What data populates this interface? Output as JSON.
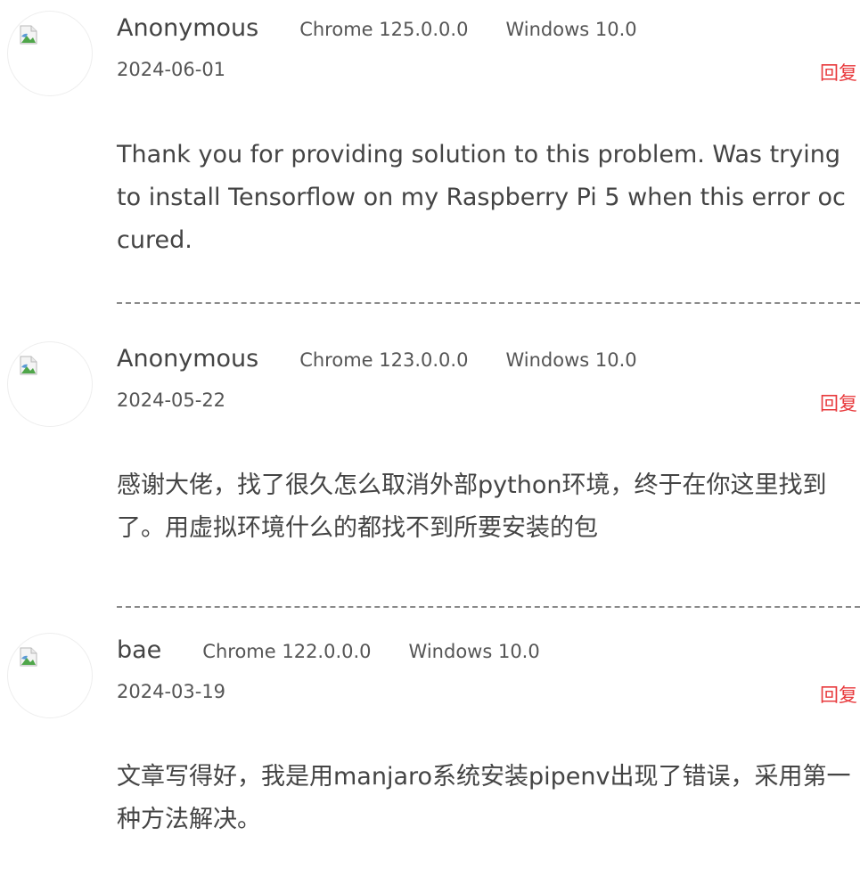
{
  "comments": [
    {
      "author": "Anonymous",
      "browser": "Chrome 125.0.0.0",
      "os": "Windows 10.0",
      "date": "2024-06-01",
      "reply_label": "回复",
      "content": "Thank you for providing solution to this problem. Was trying to install Tensorflow on my Raspberry Pi 5 when this error occured.",
      "avatar_icon": "broken-image-icon"
    },
    {
      "author": "Anonymous",
      "browser": "Chrome 123.0.0.0",
      "os": "Windows 10.0",
      "date": "2024-05-22",
      "reply_label": "回复",
      "content": "感谢大佬，找了很久怎么取消外部python环境，终于在你这里找到了。用虚拟环境什么的都找不到所要安装的包",
      "avatar_icon": "broken-image-icon"
    },
    {
      "author": "bae",
      "browser": "Chrome 122.0.0.0",
      "os": "Windows 10.0",
      "date": "2024-03-19",
      "reply_label": "回复",
      "content": "文章写得好，我是用manjaro系统安装pipenv出现了错误，采用第一种方法解决。",
      "avatar_icon": "broken-image-icon"
    }
  ],
  "colors": {
    "reply": "#e8393c",
    "text": "#444444",
    "meta": "#555555",
    "divider": "#8a8a8a"
  }
}
